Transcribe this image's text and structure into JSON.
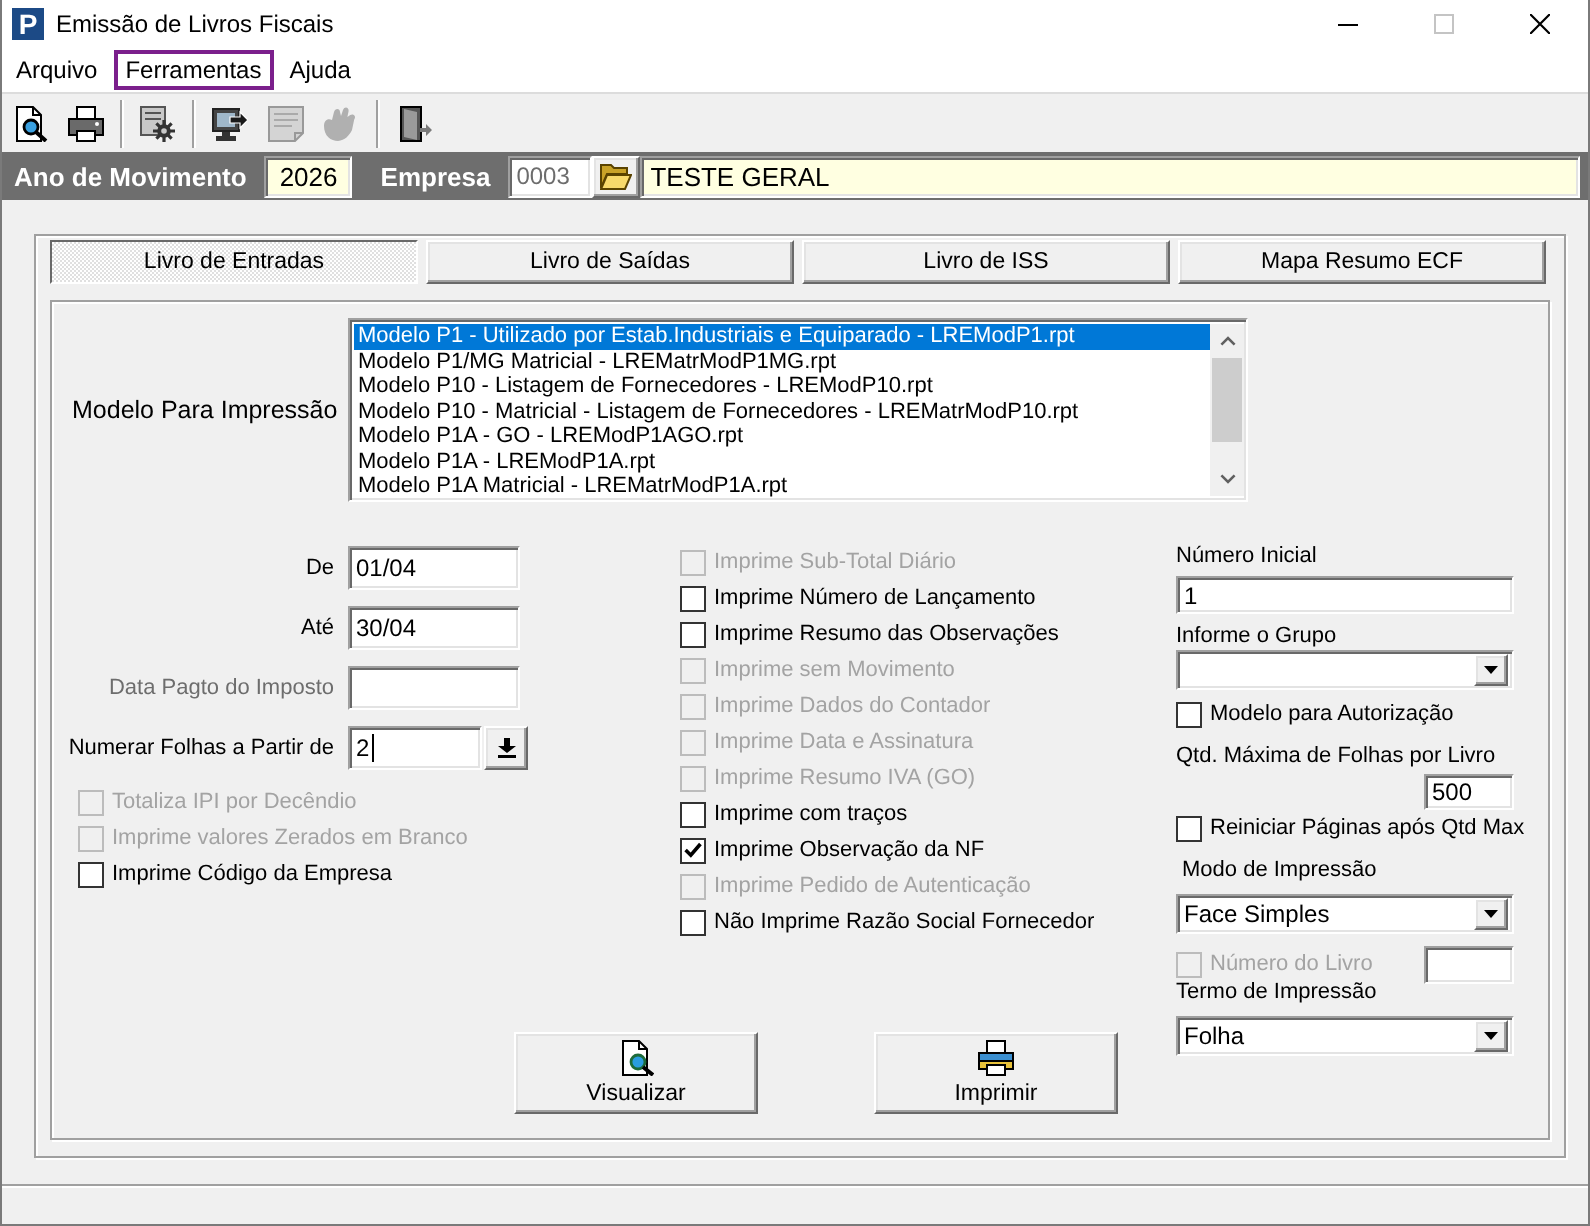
{
  "window": {
    "logo": "P",
    "title": "Emissão de Livros Fiscais",
    "can_maximize": false
  },
  "menu": [
    {
      "label": "Arquivo",
      "highlighted": false
    },
    {
      "label": "Ferramentas",
      "highlighted": true
    },
    {
      "label": "Ajuda",
      "highlighted": false
    }
  ],
  "toolbar": [
    [
      {
        "disabled": false
      },
      {
        "disabled": false
      }
    ],
    [
      {
        "disabled": false
      }
    ],
    [
      {
        "disabled": false
      },
      {
        "disabled": true
      },
      {
        "disabled": true
      }
    ],
    [
      {
        "disabled": false
      }
    ]
  ],
  "header": {
    "year_label": "Ano de Movimento",
    "year": "2026",
    "company_label": "Empresa",
    "company_code": "0003",
    "company_name": "TESTE GERAL"
  },
  "tabs": [
    {
      "label": "Livro de Entradas",
      "selected": true
    },
    {
      "label": "Livro de Saídas",
      "selected": false
    },
    {
      "label": "Livro de ISS",
      "selected": false
    },
    {
      "label": "Mapa Resumo ECF",
      "selected": false
    }
  ],
  "model": {
    "label": "Modelo Para Impressão",
    "items": [
      {
        "label": "Modelo P1 - Utilizado por Estab.Industriais e Equiparado - LREModP1.rpt",
        "selected": true
      },
      {
        "label": "Modelo P1/MG Matricial - LREMatrModP1MG.rpt",
        "selected": false
      },
      {
        "label": "Modelo P10 - Listagem de Fornecedores - LREModP10.rpt",
        "selected": false
      },
      {
        "label": "Modelo P10 - Matricial - Listagem de Fornecedores - LREMatrModP10.rpt",
        "selected": false
      },
      {
        "label": "Modelo P1A - GO - LREModP1AGO.rpt",
        "selected": false
      },
      {
        "label": "Modelo P1A - LREModP1A.rpt",
        "selected": false
      },
      {
        "label": "Modelo P1A Matricial - LREMatrModP1A.rpt",
        "selected": false
      }
    ]
  },
  "left_fields": [
    {
      "kind": "text",
      "label": "De",
      "value": "01/04",
      "disabled": false,
      "focused": false
    },
    {
      "kind": "text",
      "label": "Até",
      "value": "30/04",
      "disabled": false,
      "focused": false
    },
    {
      "kind": "text",
      "label": "Data Pagto do Imposto",
      "disabled": true,
      "focused": false
    },
    {
      "kind": "spin",
      "label": "Numerar Folhas a Partir de",
      "value": "2",
      "disabled": false,
      "focused": true
    }
  ],
  "left_checks": [
    {
      "label": "Totaliza IPI por Decêndio",
      "checked": false,
      "disabled": true
    },
    {
      "label": "Imprime valores Zerados em Branco",
      "checked": false,
      "disabled": true
    },
    {
      "label": "Imprime Código da Empresa",
      "checked": false,
      "disabled": false
    }
  ],
  "middle_checks": [
    {
      "label": "Imprime Sub-Total Diário",
      "checked": false,
      "disabled": true
    },
    {
      "label": "Imprime Número de Lançamento",
      "checked": false,
      "disabled": false
    },
    {
      "label": "Imprime Resumo das Observações",
      "checked": false,
      "disabled": false
    },
    {
      "label": "Imprime sem Movimento",
      "checked": false,
      "disabled": true
    },
    {
      "label": "Imprime Dados do Contador",
      "checked": false,
      "disabled": true
    },
    {
      "label": "Imprime Data e Assinatura",
      "checked": false,
      "disabled": true
    },
    {
      "label": "Imprime Resumo IVA (GO)",
      "checked": false,
      "disabled": true
    },
    {
      "label": "Imprime com traços",
      "checked": false,
      "disabled": false
    },
    {
      "label": "Imprime Observação da NF",
      "checked": true,
      "disabled": false
    },
    {
      "label": "Imprime Pedido de Autenticação",
      "checked": false,
      "disabled": true
    },
    {
      "label": "Não Imprime Razão Social Fornecedor",
      "checked": false,
      "disabled": false
    }
  ],
  "right_panel": {
    "initial_number": {
      "label": "Número Inicial",
      "value": "1"
    },
    "group": {
      "label": "Informe o Grupo"
    },
    "authorization": {
      "label": "Modelo para Autorização",
      "checked": false,
      "disabled": false
    },
    "max_sheets": {
      "label": "Qtd. Máxima de Folhas por Livro",
      "value": "500"
    },
    "restart_pages": {
      "label": "Reiniciar Páginas após Qtd Max",
      "checked": false,
      "disabled": false
    },
    "print_mode": {
      "label": "Modo de Impressão",
      "value": "Face Simples"
    },
    "book_number": {
      "label": "Número do Livro",
      "checked": false,
      "disabled": true
    },
    "print_term": {
      "label": "Termo de Impressão",
      "value": "Folha"
    }
  },
  "buttons": [
    {
      "label": "Visualizar"
    },
    {
      "label": "Imprimir"
    }
  ]
}
